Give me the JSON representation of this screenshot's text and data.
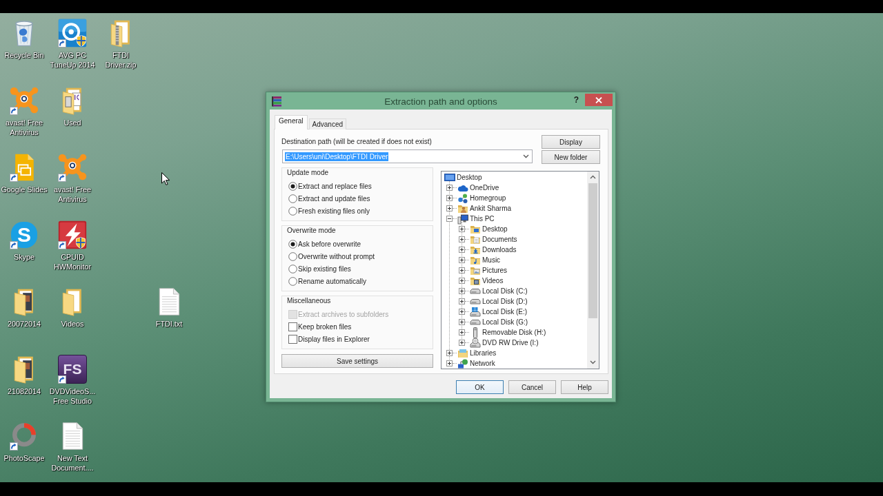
{
  "desktop": {
    "icons": [
      {
        "label": "Recycle Bin",
        "kind": "bin",
        "shortcut": false
      },
      {
        "label": "AVG PC TuneUp 2014",
        "kind": "gauge",
        "shortcut": true
      },
      {
        "label": "FTDI Driver.zip",
        "kind": "zip",
        "shortcut": false
      },
      {
        "label": "avast! Free Antivirus",
        "kind": "splat",
        "shortcut": true
      },
      {
        "label": "Used",
        "kind": "docfolder",
        "shortcut": false
      },
      {
        "label": "Google Slides",
        "kind": "slides",
        "shortcut": true
      },
      {
        "label": "avast! Free Antivirus",
        "kind": "splat",
        "shortcut": true
      },
      {
        "label": "Skype",
        "kind": "bubble",
        "logo_text": "S",
        "shortcut": true
      },
      {
        "label": "CPUID HWMonitor",
        "kind": "bolt",
        "shortcut": true
      },
      {
        "label": "20072014",
        "kind": "photofolder",
        "shortcut": false
      },
      {
        "label": "Videos",
        "kind": "folder",
        "shortcut": false
      },
      {
        "label": "FTDI.txt",
        "kind": "textfile",
        "shortcut": false
      },
      {
        "label": "21082014",
        "kind": "photofolder",
        "shortcut": false
      },
      {
        "label": "DVDVideoS... Free Studio",
        "kind": "tile",
        "logo_text": "FS",
        "shortcut": true
      },
      {
        "label": "PhotoScape",
        "kind": "ring",
        "shortcut": true
      },
      {
        "label": "New Text Document....",
        "kind": "textfile",
        "shortcut": false
      }
    ]
  },
  "dialog": {
    "title": "Extraction path and options",
    "help_button": "?",
    "tabs": [
      {
        "label": "General",
        "selected": true
      },
      {
        "label": "Advanced",
        "selected": false
      }
    ],
    "destination": {
      "label": "Destination path (will be created if does not exist)",
      "value": "E:\\Users\\uni\\Desktop\\FTDI Driver",
      "highlighted": true
    },
    "path_buttons": [
      "Display",
      "New folder"
    ],
    "groups": [
      {
        "title": "Update mode",
        "kind": "radio",
        "options": [
          {
            "label": "Extract and replace files",
            "selected": true
          },
          {
            "label": "Extract and update files",
            "selected": false
          },
          {
            "label": "Fresh existing files only",
            "selected": false
          }
        ]
      },
      {
        "title": "Overwrite mode",
        "kind": "radio",
        "options": [
          {
            "label": "Ask before overwrite",
            "selected": true
          },
          {
            "label": "Overwrite without prompt",
            "selected": false
          },
          {
            "label": "Skip existing files",
            "selected": false
          },
          {
            "label": "Rename automatically",
            "selected": false
          }
        ]
      },
      {
        "title": "Miscellaneous",
        "kind": "checkbox",
        "options": [
          {
            "label": "Extract archives to subfolders",
            "checked": false,
            "disabled": true
          },
          {
            "label": "Keep broken files",
            "checked": false,
            "disabled": false
          },
          {
            "label": "Display files in Explorer",
            "checked": false,
            "disabled": false
          }
        ]
      }
    ],
    "save_button": "Save settings",
    "tree": {
      "label": "Desktop",
      "kind": "desktop",
      "children": [
        {
          "label": "OneDrive",
          "kind": "cloud",
          "expanded": false
        },
        {
          "label": "Homegroup",
          "kind": "homegroup",
          "expanded": false
        },
        {
          "label": "Ankit Sharma",
          "kind": "user",
          "expanded": false
        },
        {
          "label": "This PC",
          "kind": "computer",
          "expanded": true,
          "children": [
            {
              "label": "Desktop",
              "kind": "desktopfolder",
              "expanded": false
            },
            {
              "label": "Documents",
              "kind": "documents",
              "expanded": false
            },
            {
              "label": "Downloads",
              "kind": "downloads",
              "expanded": false
            },
            {
              "label": "Music",
              "kind": "music",
              "expanded": false
            },
            {
              "label": "Pictures",
              "kind": "pictures",
              "expanded": false
            },
            {
              "label": "Videos",
              "kind": "videos",
              "expanded": false
            },
            {
              "label": "Local Disk (C:)",
              "kind": "disk",
              "expanded": false
            },
            {
              "label": "Local Disk (D:)",
              "kind": "disk",
              "expanded": false
            },
            {
              "label": "Local Disk (E:)",
              "kind": "sysdisk",
              "expanded": false
            },
            {
              "label": "Local Disk (G:)",
              "kind": "disk",
              "expanded": false
            },
            {
              "label": "Removable Disk (H:)",
              "kind": "removable",
              "expanded": false
            },
            {
              "label": "DVD RW Drive (I:)",
              "kind": "dvd",
              "expanded": false
            }
          ]
        },
        {
          "label": "Libraries",
          "kind": "libraries",
          "expanded": false
        },
        {
          "label": "Network",
          "kind": "network",
          "expanded": false
        }
      ]
    },
    "buttons": [
      {
        "label": "OK",
        "default": true
      },
      {
        "label": "Cancel",
        "default": false
      },
      {
        "label": "Help",
        "default": false
      }
    ]
  }
}
